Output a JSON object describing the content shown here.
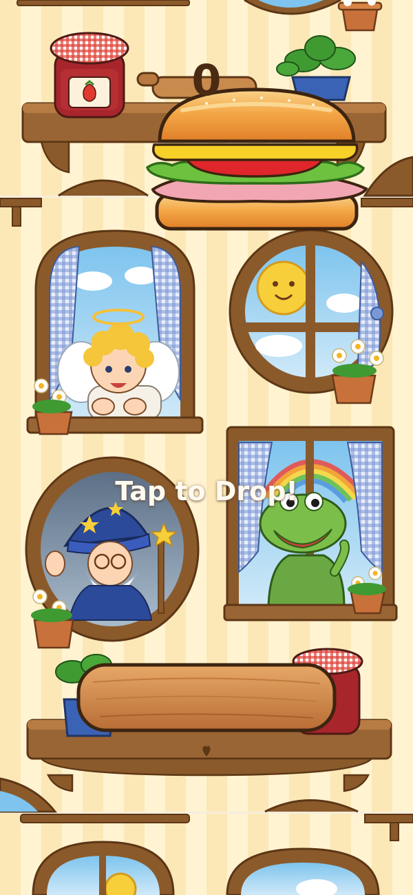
{
  "game": {
    "score": "0",
    "hint": "Tap to Drop!"
  },
  "stack": {
    "falling_piece": [
      "top-bun",
      "cheese",
      "tomato",
      "lettuce",
      "ham",
      "bottom-bun"
    ],
    "base": "wooden-cutting-board"
  },
  "scene": {
    "windows": [
      "angel-window",
      "sun-window",
      "wizard-window",
      "dinosaur-window"
    ],
    "jam_label": "strawberry"
  },
  "colors": {
    "wall_stripe_a": "#fbe8b6",
    "wall_stripe_b": "#fff3d2",
    "wood": "#8b5a2b",
    "bun": "#f0a040",
    "score_text": "#4a2a12",
    "hint_text": "#fffaf0"
  }
}
